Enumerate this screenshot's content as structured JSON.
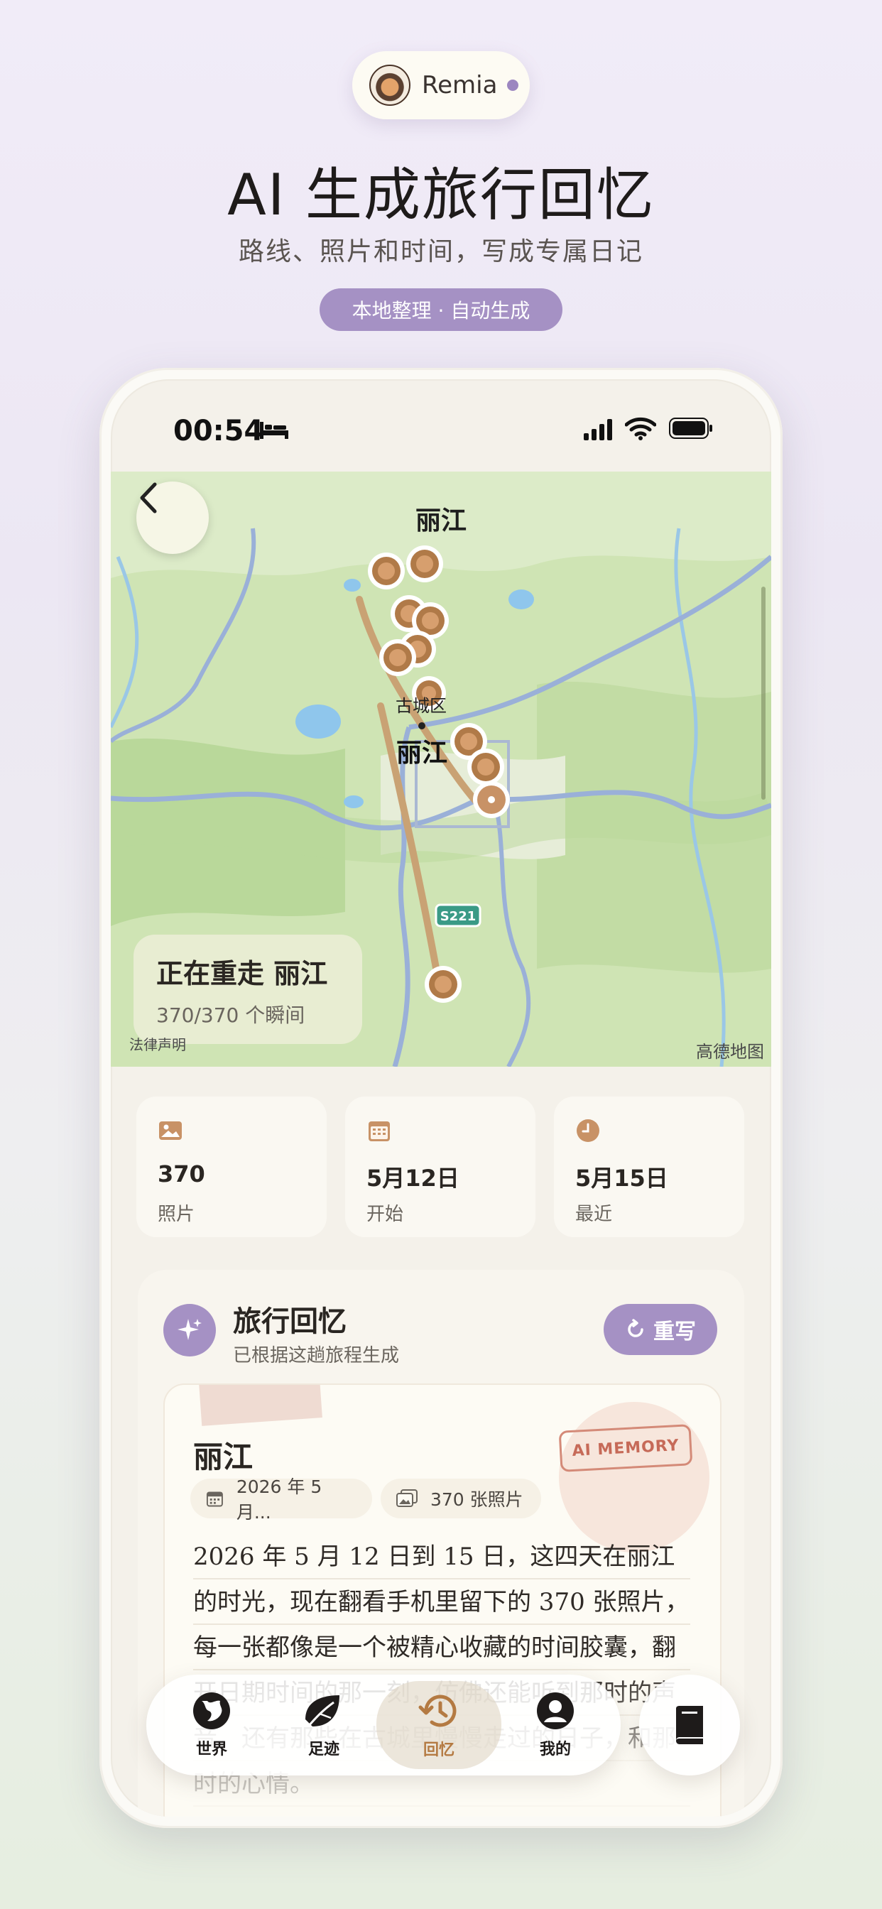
{
  "brand": {
    "name": "Remia"
  },
  "hero": {
    "title": "AI 生成旅行回忆",
    "subtitle": "路线、照片和时间，写成专属日记",
    "badge": "本地整理 · 自动生成"
  },
  "status_bar": {
    "time": "00:54"
  },
  "map": {
    "title": "丽江",
    "city_label": "丽江",
    "district_label": "古城区",
    "road_label": "S221",
    "credit": "高德地图",
    "legal": "法律声明",
    "replay_title": "正在重走 丽江",
    "replay_count": "370/370 个瞬间"
  },
  "stats": [
    {
      "icon": "photo-icon",
      "value": "370",
      "label": "照片"
    },
    {
      "icon": "calendar-icon",
      "value": "5月12日",
      "label": "开始"
    },
    {
      "icon": "clock-icon",
      "value": "5月15日",
      "label": "最近"
    }
  ],
  "memory": {
    "title": "旅行回忆",
    "subtitle": "已根据这趟旅程生成",
    "rewrite": "重写",
    "stamp": "AI MEMORY",
    "diary_title": "丽江",
    "date_chip": "2026 年 5 月...",
    "photo_chip": "370 张照片",
    "body": "2026 年 5 月 12 日到 15 日，这四天在丽江的时光，现在翻看手机里留下的 370 张照片，每一张都像是一个被精心收藏的时间胶囊，翻开日期时间的那一刻，仿佛还能听到那时的声音，还有那些在古城里慢慢走过的日子，和那时的心情。"
  },
  "tabs": [
    {
      "label": "世界",
      "icon": "globe-icon"
    },
    {
      "label": "足迹",
      "icon": "leaf-icon"
    },
    {
      "label": "回忆",
      "icon": "history-icon",
      "active": true
    },
    {
      "label": "我的",
      "icon": "profile-icon"
    }
  ],
  "colors": {
    "accent": "#a591c4",
    "route": "#c9a274",
    "active_tab": "#b47a42"
  }
}
